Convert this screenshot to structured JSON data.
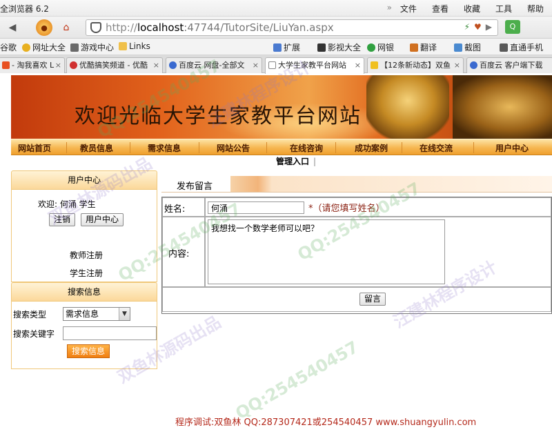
{
  "browser": {
    "title": "全浏览器 6.2",
    "menu": [
      "文件",
      "查看",
      "收藏",
      "工具",
      "帮助"
    ],
    "url_host": "localhost",
    "url_rest": ":47744/TutorSite/LiuYan.aspx",
    "bookmarks": [
      "谷歌",
      "网址大全",
      "游戏中心",
      "Links",
      "扩展",
      "影视大全",
      "网银",
      "翻译",
      "截图",
      "直通手机"
    ],
    "tabs": [
      {
        "label": "- 淘我喜欢 L",
        "active": false
      },
      {
        "label": "优酷搞笑频道 - 优酷",
        "active": false
      },
      {
        "label": "百度云 网盘-全部文",
        "active": false
      },
      {
        "label": "大学生家教平台网站",
        "active": true
      },
      {
        "label": "【12条新动态】双鱼",
        "active": false
      },
      {
        "label": "百度云 客户端下载",
        "active": false
      }
    ]
  },
  "site": {
    "headline": "欢迎光临大学生家教平台网站",
    "nav": [
      "网站首页",
      "教员信息",
      "需求信息",
      "网站公告",
      "在线咨询",
      "成功案例",
      "在线交流",
      "用户中心"
    ],
    "admin_entry": "管理入口",
    "admin_bar": "|"
  },
  "sidebar": {
    "user_center_title": "用户中心",
    "welcome": "欢迎: 何涌 学生",
    "logout_label": "注销",
    "user_center_button": "用户中心",
    "teacher_register": "教师注册",
    "student_register": "学生注册",
    "search_title": "搜索信息",
    "search_type_label": "搜索类型",
    "search_type_value": "需求信息",
    "search_keyword_label": "搜索关键字",
    "search_keyword_value": "",
    "search_button": "搜索信息"
  },
  "form": {
    "title": "发布留言",
    "name_label": "姓名:",
    "name_value": "何涌",
    "name_hint": "*（请您填写姓名）",
    "content_label": "内容:",
    "content_value": "我想找一个数学老师可以吧？",
    "submit_label": "留言"
  },
  "credit": "程序调试:双鱼林 QQ:287307421或254540457 www.shuangyulin.com",
  "watermarks": [
    "QQ:254540457",
    "汪建林程序设计",
    "双鱼林源码出品"
  ]
}
